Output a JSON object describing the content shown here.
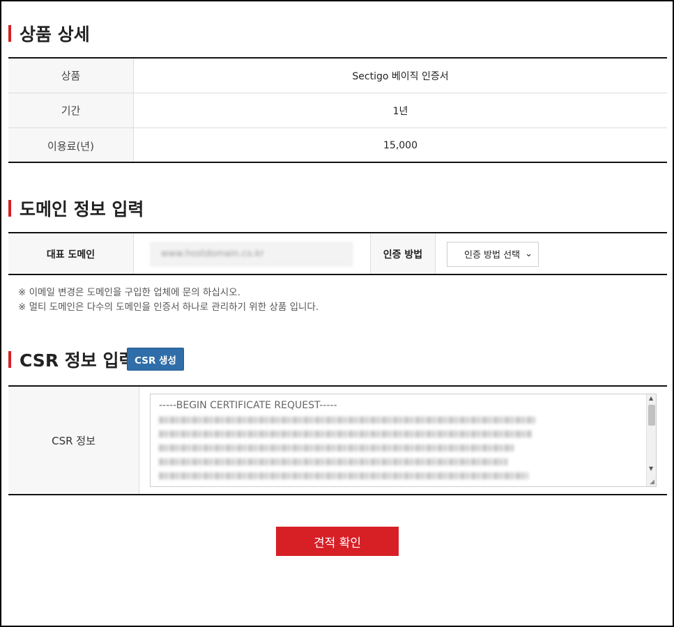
{
  "product_section": {
    "title": "상품 상세",
    "rows": [
      {
        "label": "상품",
        "value": "Sectigo 베이직 인증서"
      },
      {
        "label": "기간",
        "value": "1년"
      },
      {
        "label": "이용료(년)",
        "value": "15,000"
      }
    ]
  },
  "domain_section": {
    "title": "도메인 정보 입력",
    "domain_label": "대표 도메인",
    "domain_value": "www.hostdomain.co.kr",
    "method_label": "인증 방법",
    "method_selected": "인증 방법 선택",
    "notes": [
      "※ 이메일 변경은 도메인을 구입한 업체에 문의 하십시오.",
      "※ 멀티 도메인은 다수의 도메인을 인증서 하나로 관리하기 위한 상품 입니다."
    ]
  },
  "csr_section": {
    "title": "CSR 정보 입력",
    "generate_button": "CSR 생성",
    "label": "CSR 정보",
    "first_line": "-----BEGIN CERTIFICATE REQUEST-----"
  },
  "confirm_button": "견적 확인",
  "colors": {
    "accent_red": "#d71f26",
    "button_blue": "#2f6ea9"
  }
}
